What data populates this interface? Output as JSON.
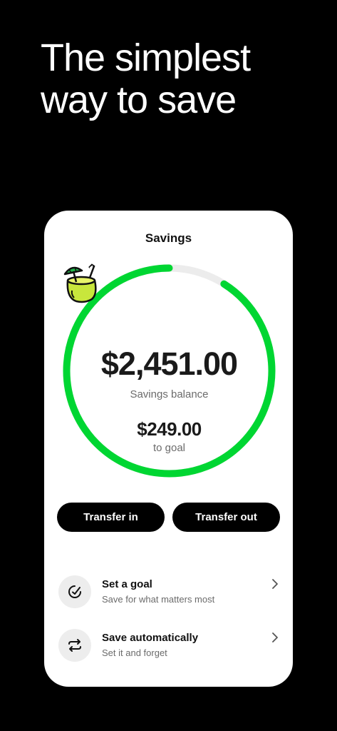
{
  "headline": {
    "line1": "The simplest",
    "line2": "way to save"
  },
  "card": {
    "title": "Savings",
    "balance": "$2,451.00",
    "balance_label": "Savings balance",
    "goal_amount": "$249.00",
    "goal_label": "to goal",
    "progress_fraction": 0.91
  },
  "actions": {
    "transfer_in": "Transfer in",
    "transfer_out": "Transfer out"
  },
  "options": [
    {
      "title": "Set a goal",
      "subtitle": "Save for what matters most",
      "icon": "goal-icon"
    },
    {
      "title": "Save automatically",
      "subtitle": "Set it and forget",
      "icon": "repeat-icon"
    }
  ],
  "colors": {
    "accent": "#00d632",
    "track": "#ececec",
    "background": "#000000",
    "card": "#ffffff"
  }
}
